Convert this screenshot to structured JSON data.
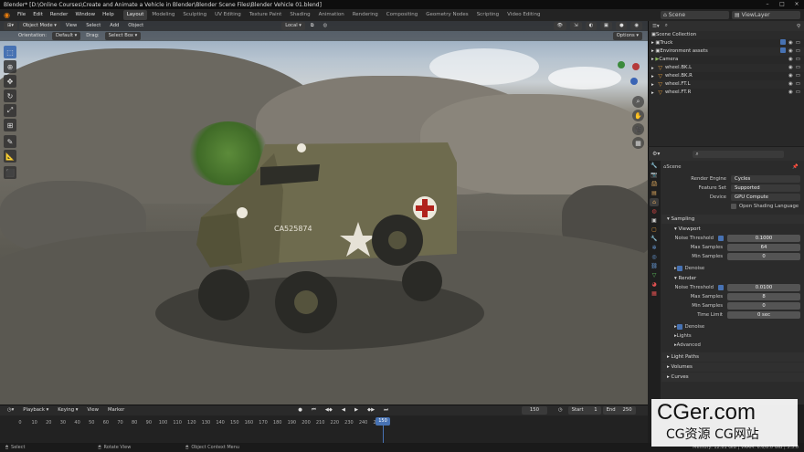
{
  "title": "Blender* [D:\\Online Courses\\Create and Animate a Vehicle in Blender\\Blender Scene Files\\Blender Vehicle 01.blend]",
  "menu": [
    "File",
    "Edit",
    "Render",
    "Window",
    "Help"
  ],
  "workspaces": [
    "Layout",
    "Modeling",
    "Sculpting",
    "UV Editing",
    "Texture Paint",
    "Shading",
    "Animation",
    "Rendering",
    "Compositing",
    "Geometry Nodes",
    "Scripting",
    "Video Editing"
  ],
  "scene_name": "Scene",
  "view_layer": "ViewLayer",
  "viewport": {
    "mode": "Object Mode",
    "menus": [
      "View",
      "Select",
      "Add",
      "Object"
    ],
    "transform": "Local",
    "orientation_label": "Orientation:",
    "orientation_value": "Default",
    "drag_label": "Drag:",
    "drag_value": "Select Box",
    "options": "Options",
    "vehicle_id": "CA525874"
  },
  "outliner": {
    "root": "Scene Collection",
    "items": [
      "Truck",
      "Environment assets",
      "Camera",
      "wheel.BK.L",
      "wheel.BK.R",
      "wheel.FT.L",
      "wheel.FT.R"
    ]
  },
  "properties": {
    "context": "Scene",
    "render_engine_label": "Render Engine",
    "render_engine": "Cycles",
    "feature_set_label": "Feature Set",
    "feature_set": "Supported",
    "device_label": "Device",
    "device": "GPU Compute",
    "osl": "Open Shading Language",
    "sampling": "Sampling",
    "viewport": "Viewport",
    "noise_threshold_label": "Noise Threshold",
    "vp_noise_threshold": "0.1000",
    "max_samples_label": "Max Samples",
    "vp_max_samples": "64",
    "min_samples_label": "Min Samples",
    "vp_min_samples": "0",
    "denoise": "Denoise",
    "render": "Render",
    "r_noise_threshold": "0.0100",
    "r_max_samples": "8",
    "r_min_samples": "0",
    "time_limit_label": "Time Limit",
    "time_limit": "0 sec",
    "r_denoise": "Denoise",
    "lights": "Lights",
    "advanced": "Advanced",
    "light_paths": "Light Paths",
    "volumes": "Volumes",
    "curves": "Curves"
  },
  "timeline": {
    "menus": [
      "Playback",
      "Keying",
      "View",
      "Marker"
    ],
    "current_frame": "150",
    "start_label": "Start",
    "start": "1",
    "end_label": "End",
    "end": "250",
    "ticks": [
      "0",
      "10",
      "20",
      "30",
      "40",
      "50",
      "60",
      "70",
      "80",
      "90",
      "100",
      "110",
      "120",
      "130",
      "140",
      "150",
      "160",
      "170",
      "180",
      "190",
      "200",
      "210",
      "220",
      "230",
      "240",
      "250"
    ]
  },
  "statusbar": {
    "left": "Select",
    "middle": "Rotate View",
    "right": "Object Context Menu",
    "memory": "Memory: 12.81 GiB | VRAM: 6.6/8.0 GiB | 3.3.0"
  },
  "watermark": {
    "line1": "CGer.com",
    "line2": "CG资源 CG网站"
  },
  "colors": {
    "accent": "#4772b3",
    "object_orange": "#e39b3b"
  }
}
